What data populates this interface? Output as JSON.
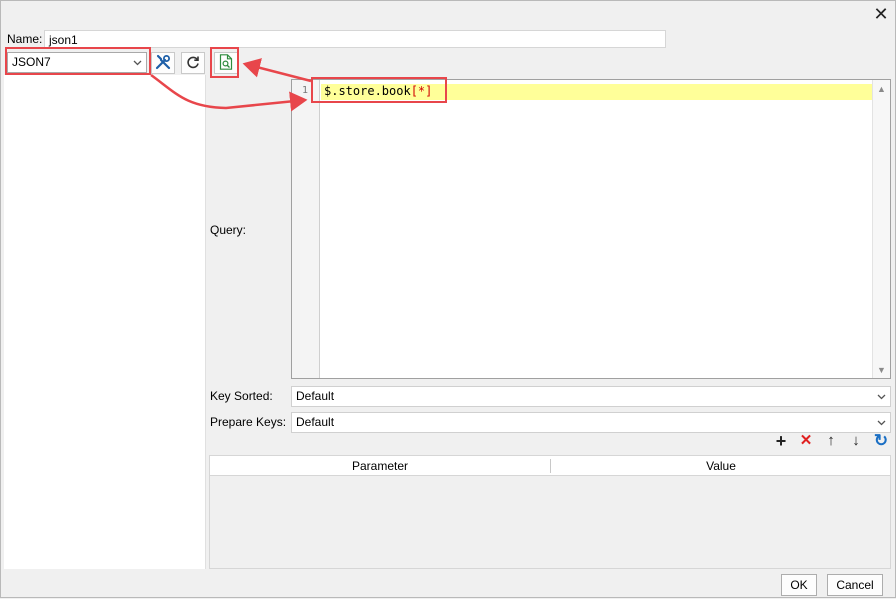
{
  "dialog": {
    "close_glyph": "✕"
  },
  "name_field": {
    "label": "Name:",
    "value": "json1"
  },
  "connection": {
    "selected": "JSON7"
  },
  "toolbar": {
    "edit_icon": "tools-icon",
    "refresh_icon": "refresh-icon",
    "preview_icon": "document-preview-icon"
  },
  "query": {
    "label": "Query:",
    "line_number": "1",
    "code_main": "$.store.book",
    "code_bracket": "[*]"
  },
  "key_sorted": {
    "label": "Key Sorted:",
    "selected": "Default"
  },
  "prepare_keys": {
    "label": "Prepare Keys:",
    "selected": "Default"
  },
  "param_toolbar": {
    "add": "+",
    "delete": "✕",
    "up": "↑",
    "down": "↓",
    "refresh": "↻"
  },
  "params_table": {
    "columns": [
      "Parameter",
      "Value"
    ],
    "rows": []
  },
  "buttons": {
    "ok": "OK",
    "cancel": "Cancel"
  },
  "colors": {
    "highlight": "#e8464b",
    "current_line": "#ffff99",
    "delete_red": "#e02020",
    "refresh_blue": "#1a6fc4"
  }
}
